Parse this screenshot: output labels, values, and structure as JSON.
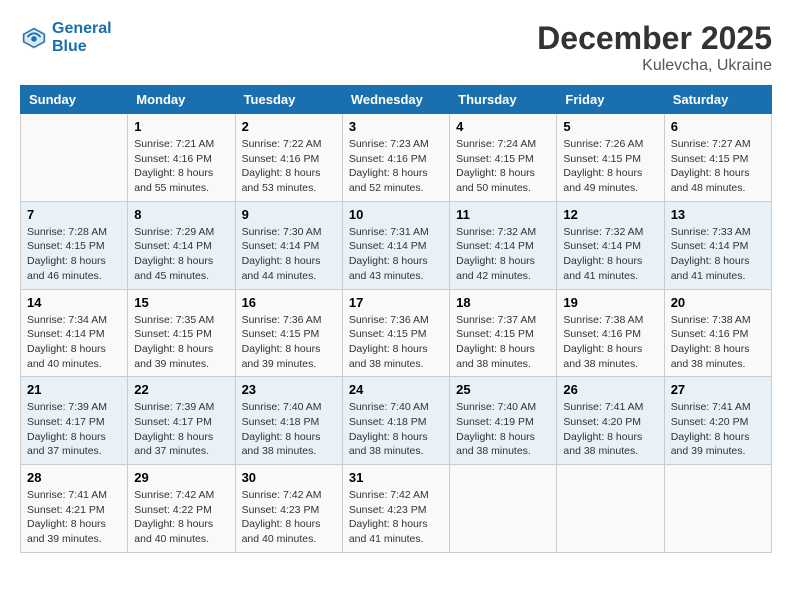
{
  "header": {
    "logo_line1": "General",
    "logo_line2": "Blue",
    "month_year": "December 2025",
    "location": "Kulevcha, Ukraine"
  },
  "days_of_week": [
    "Sunday",
    "Monday",
    "Tuesday",
    "Wednesday",
    "Thursday",
    "Friday",
    "Saturday"
  ],
  "weeks": [
    [
      {
        "day": "",
        "sunrise": "",
        "sunset": "",
        "daylight": ""
      },
      {
        "day": "1",
        "sunrise": "Sunrise: 7:21 AM",
        "sunset": "Sunset: 4:16 PM",
        "daylight": "Daylight: 8 hours and 55 minutes."
      },
      {
        "day": "2",
        "sunrise": "Sunrise: 7:22 AM",
        "sunset": "Sunset: 4:16 PM",
        "daylight": "Daylight: 8 hours and 53 minutes."
      },
      {
        "day": "3",
        "sunrise": "Sunrise: 7:23 AM",
        "sunset": "Sunset: 4:16 PM",
        "daylight": "Daylight: 8 hours and 52 minutes."
      },
      {
        "day": "4",
        "sunrise": "Sunrise: 7:24 AM",
        "sunset": "Sunset: 4:15 PM",
        "daylight": "Daylight: 8 hours and 50 minutes."
      },
      {
        "day": "5",
        "sunrise": "Sunrise: 7:26 AM",
        "sunset": "Sunset: 4:15 PM",
        "daylight": "Daylight: 8 hours and 49 minutes."
      },
      {
        "day": "6",
        "sunrise": "Sunrise: 7:27 AM",
        "sunset": "Sunset: 4:15 PM",
        "daylight": "Daylight: 8 hours and 48 minutes."
      }
    ],
    [
      {
        "day": "7",
        "sunrise": "Sunrise: 7:28 AM",
        "sunset": "Sunset: 4:15 PM",
        "daylight": "Daylight: 8 hours and 46 minutes."
      },
      {
        "day": "8",
        "sunrise": "Sunrise: 7:29 AM",
        "sunset": "Sunset: 4:14 PM",
        "daylight": "Daylight: 8 hours and 45 minutes."
      },
      {
        "day": "9",
        "sunrise": "Sunrise: 7:30 AM",
        "sunset": "Sunset: 4:14 PM",
        "daylight": "Daylight: 8 hours and 44 minutes."
      },
      {
        "day": "10",
        "sunrise": "Sunrise: 7:31 AM",
        "sunset": "Sunset: 4:14 PM",
        "daylight": "Daylight: 8 hours and 43 minutes."
      },
      {
        "day": "11",
        "sunrise": "Sunrise: 7:32 AM",
        "sunset": "Sunset: 4:14 PM",
        "daylight": "Daylight: 8 hours and 42 minutes."
      },
      {
        "day": "12",
        "sunrise": "Sunrise: 7:32 AM",
        "sunset": "Sunset: 4:14 PM",
        "daylight": "Daylight: 8 hours and 41 minutes."
      },
      {
        "day": "13",
        "sunrise": "Sunrise: 7:33 AM",
        "sunset": "Sunset: 4:14 PM",
        "daylight": "Daylight: 8 hours and 41 minutes."
      }
    ],
    [
      {
        "day": "14",
        "sunrise": "Sunrise: 7:34 AM",
        "sunset": "Sunset: 4:14 PM",
        "daylight": "Daylight: 8 hours and 40 minutes."
      },
      {
        "day": "15",
        "sunrise": "Sunrise: 7:35 AM",
        "sunset": "Sunset: 4:15 PM",
        "daylight": "Daylight: 8 hours and 39 minutes."
      },
      {
        "day": "16",
        "sunrise": "Sunrise: 7:36 AM",
        "sunset": "Sunset: 4:15 PM",
        "daylight": "Daylight: 8 hours and 39 minutes."
      },
      {
        "day": "17",
        "sunrise": "Sunrise: 7:36 AM",
        "sunset": "Sunset: 4:15 PM",
        "daylight": "Daylight: 8 hours and 38 minutes."
      },
      {
        "day": "18",
        "sunrise": "Sunrise: 7:37 AM",
        "sunset": "Sunset: 4:15 PM",
        "daylight": "Daylight: 8 hours and 38 minutes."
      },
      {
        "day": "19",
        "sunrise": "Sunrise: 7:38 AM",
        "sunset": "Sunset: 4:16 PM",
        "daylight": "Daylight: 8 hours and 38 minutes."
      },
      {
        "day": "20",
        "sunrise": "Sunrise: 7:38 AM",
        "sunset": "Sunset: 4:16 PM",
        "daylight": "Daylight: 8 hours and 38 minutes."
      }
    ],
    [
      {
        "day": "21",
        "sunrise": "Sunrise: 7:39 AM",
        "sunset": "Sunset: 4:17 PM",
        "daylight": "Daylight: 8 hours and 37 minutes."
      },
      {
        "day": "22",
        "sunrise": "Sunrise: 7:39 AM",
        "sunset": "Sunset: 4:17 PM",
        "daylight": "Daylight: 8 hours and 37 minutes."
      },
      {
        "day": "23",
        "sunrise": "Sunrise: 7:40 AM",
        "sunset": "Sunset: 4:18 PM",
        "daylight": "Daylight: 8 hours and 38 minutes."
      },
      {
        "day": "24",
        "sunrise": "Sunrise: 7:40 AM",
        "sunset": "Sunset: 4:18 PM",
        "daylight": "Daylight: 8 hours and 38 minutes."
      },
      {
        "day": "25",
        "sunrise": "Sunrise: 7:40 AM",
        "sunset": "Sunset: 4:19 PM",
        "daylight": "Daylight: 8 hours and 38 minutes."
      },
      {
        "day": "26",
        "sunrise": "Sunrise: 7:41 AM",
        "sunset": "Sunset: 4:20 PM",
        "daylight": "Daylight: 8 hours and 38 minutes."
      },
      {
        "day": "27",
        "sunrise": "Sunrise: 7:41 AM",
        "sunset": "Sunset: 4:20 PM",
        "daylight": "Daylight: 8 hours and 39 minutes."
      }
    ],
    [
      {
        "day": "28",
        "sunrise": "Sunrise: 7:41 AM",
        "sunset": "Sunset: 4:21 PM",
        "daylight": "Daylight: 8 hours and 39 minutes."
      },
      {
        "day": "29",
        "sunrise": "Sunrise: 7:42 AM",
        "sunset": "Sunset: 4:22 PM",
        "daylight": "Daylight: 8 hours and 40 minutes."
      },
      {
        "day": "30",
        "sunrise": "Sunrise: 7:42 AM",
        "sunset": "Sunset: 4:23 PM",
        "daylight": "Daylight: 8 hours and 40 minutes."
      },
      {
        "day": "31",
        "sunrise": "Sunrise: 7:42 AM",
        "sunset": "Sunset: 4:23 PM",
        "daylight": "Daylight: 8 hours and 41 minutes."
      },
      {
        "day": "",
        "sunrise": "",
        "sunset": "",
        "daylight": ""
      },
      {
        "day": "",
        "sunrise": "",
        "sunset": "",
        "daylight": ""
      },
      {
        "day": "",
        "sunrise": "",
        "sunset": "",
        "daylight": ""
      }
    ]
  ]
}
